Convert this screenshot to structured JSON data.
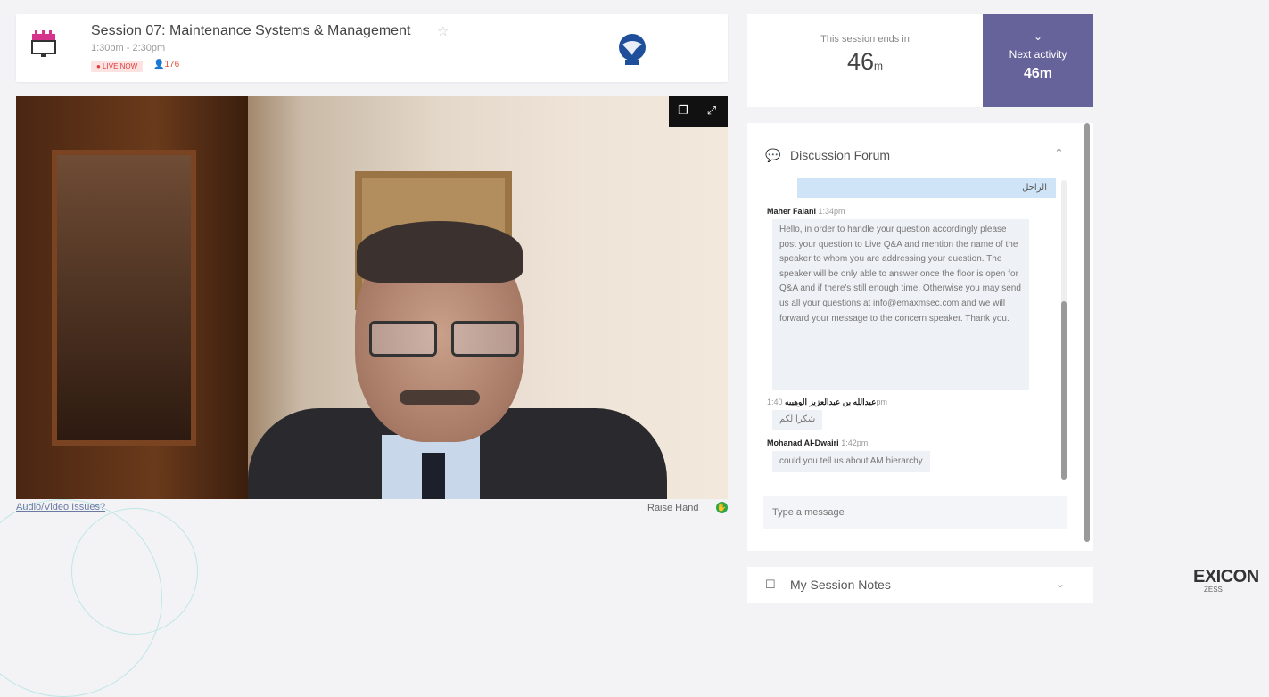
{
  "session": {
    "title": "Session 07: Maintenance Systems & Management",
    "star": "☆",
    "time": "1:30pm - 2:30pm",
    "live_badge": "● LIVE NOW",
    "viewers": "176",
    "viewer_icon": "person-icon"
  },
  "video": {
    "controls": [
      "picture-in-picture-icon",
      "fullscreen-icon"
    ],
    "pip_glyph": "❐",
    "fullscreen_glyph": "⤢"
  },
  "below_video": {
    "av_issues": "Audio/Video Issues?",
    "raise_hand": "Raise Hand"
  },
  "timer": {
    "ends_label": "This session ends in",
    "ends_value": "46",
    "ends_unit": "m",
    "next_chevron": "⌄",
    "next_label": "Next activity",
    "next_value": "46m"
  },
  "forum": {
    "title": "Discussion Forum",
    "collapse": "⌃",
    "self_message": "الراحل",
    "messages": [
      {
        "author": "Maher Falani",
        "time": "1:34pm",
        "text": "Hello, in order to handle your question accordingly please post your question to Live Q&A and mention the name of the speaker to whom you are addressing your question. The speaker will be only able to answer once the floor is open for Q&A and if there's still enough time. Otherwise you may send us all your questions at info@emaxmsec.com and we will forward your message to the concern speaker. Thank you."
      },
      {
        "author": "عبدالله بن عبدالعزيز الوهيبه",
        "time": "1:40pm",
        "text": "شكرا لكم"
      },
      {
        "author": "Mohanad Al-Dwairi",
        "time": "1:42pm",
        "text": "could you tell us about AM hierarchy"
      }
    ],
    "input_placeholder": "Type a message"
  },
  "notes": {
    "title": "My Session Notes",
    "chevron": "⌄"
  },
  "brand": {
    "name": "EXICON",
    "sub": "ZESS"
  },
  "colors": {
    "accent_purple": "#66639a",
    "live_red": "#e03b3b",
    "raise_hand_green": "#2aa84a",
    "self_bubble": "#cfe5f7"
  }
}
